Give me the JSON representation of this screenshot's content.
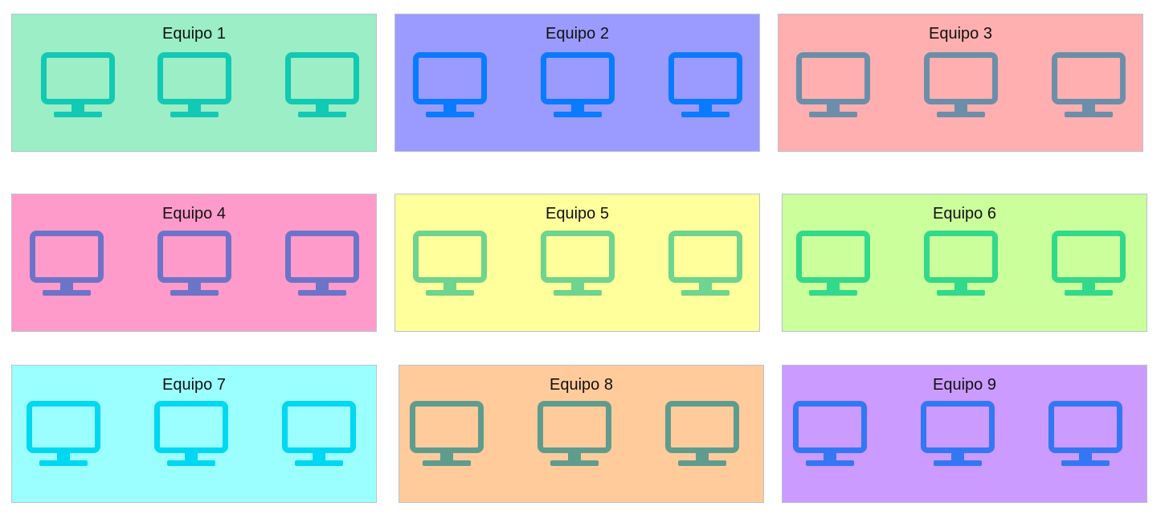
{
  "teams": [
    {
      "title": "Equipo 1",
      "background": "#9BEEC5",
      "icon_color": "#12C9B4",
      "icon": "monitor-icon",
      "computers": 3
    },
    {
      "title": "Equipo 2",
      "background": "#9B9BFF",
      "icon_color": "#0A7BFF",
      "icon": "monitor-icon",
      "computers": 3
    },
    {
      "title": "Equipo 3",
      "background": "#FFAFAF",
      "icon_color": "#6B8FA8",
      "icon": "monitor-icon",
      "computers": 3
    },
    {
      "title": "Equipo 4",
      "background": "#FF9BCB",
      "icon_color": "#6D74C7",
      "icon": "monitor-icon",
      "computers": 3
    },
    {
      "title": "Equipo 5",
      "background": "#FFFF9B",
      "icon_color": "#6ED48E",
      "icon": "monitor-icon",
      "computers": 3
    },
    {
      "title": "Equipo 6",
      "background": "#CBFF9B",
      "icon_color": "#33D98A",
      "icon": "monitor-icon",
      "computers": 3
    },
    {
      "title": "Equipo 7",
      "background": "#9BFFFF",
      "icon_color": "#00D7F2",
      "icon": "monitor-icon",
      "computers": 3
    },
    {
      "title": "Equipo 8",
      "background": "#FFCB9B",
      "icon_color": "#5F9C8E",
      "icon": "monitor-icon",
      "computers": 3
    },
    {
      "title": "Equipo 9",
      "background": "#CB9BFF",
      "icon_color": "#3377F4",
      "icon": "monitor-icon",
      "computers": 3
    }
  ]
}
